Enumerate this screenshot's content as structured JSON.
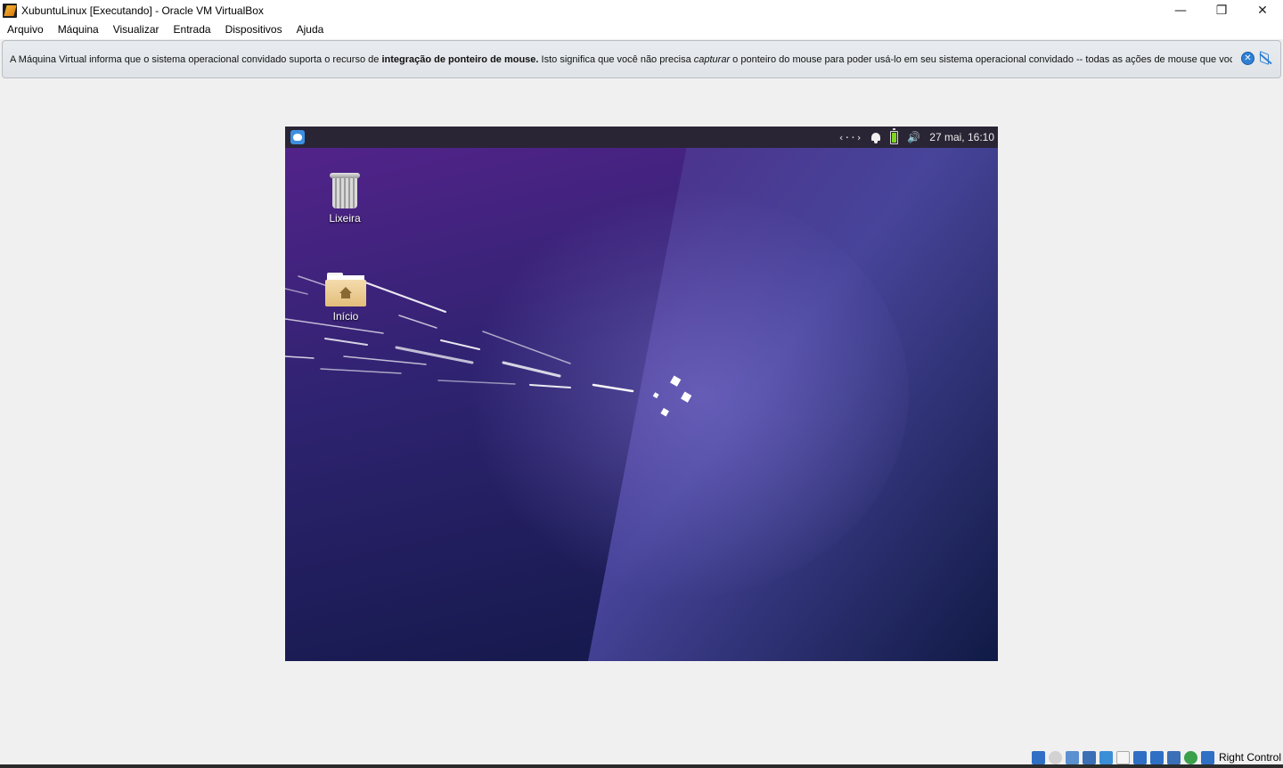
{
  "window": {
    "title": "XubuntuLinux [Executando] - Oracle VM VirtualBox",
    "minimize": "—",
    "restore": "❐",
    "close": "✕"
  },
  "menu": {
    "items": [
      "Arquivo",
      "Máquina",
      "Visualizar",
      "Entrada",
      "Dispositivos",
      "Ajuda"
    ]
  },
  "notice": {
    "part1": "A Máquina Virtual informa que o sistema operacional convidado suporta o recurso de ",
    "bold": "integração de ponteiro de mouse.",
    "part2": " Isto significa que você não precisa ",
    "italic": "capturar",
    "part3": " o ponteiro do mouse para poder usá-lo em seu sistema operacional convidado -- todas as ações de mouse que você",
    "close_symbol": "✕"
  },
  "guest": {
    "panel": {
      "network_symbol": "‹··›",
      "volume_symbol": "🔊",
      "clock": "27 mai, 16:10"
    },
    "desktop_icons": {
      "trash_label": "Lixeira",
      "home_label": "Início"
    },
    "wallpaper_colors": {
      "top": "#4b2383",
      "bottom": "#12184a",
      "accent": "#6a57b8"
    }
  },
  "statusbar": {
    "host_key": "Right Control",
    "icon_colors": [
      "#2f6fc4",
      "#bdbdbd",
      "#3b6fb6",
      "#3b6fb6",
      "#3b8fd6",
      "#ededed",
      "#2f6fc4",
      "#2f6fc4",
      "#3b6fb6",
      "#3aa04a",
      "#2f6fc4"
    ]
  }
}
